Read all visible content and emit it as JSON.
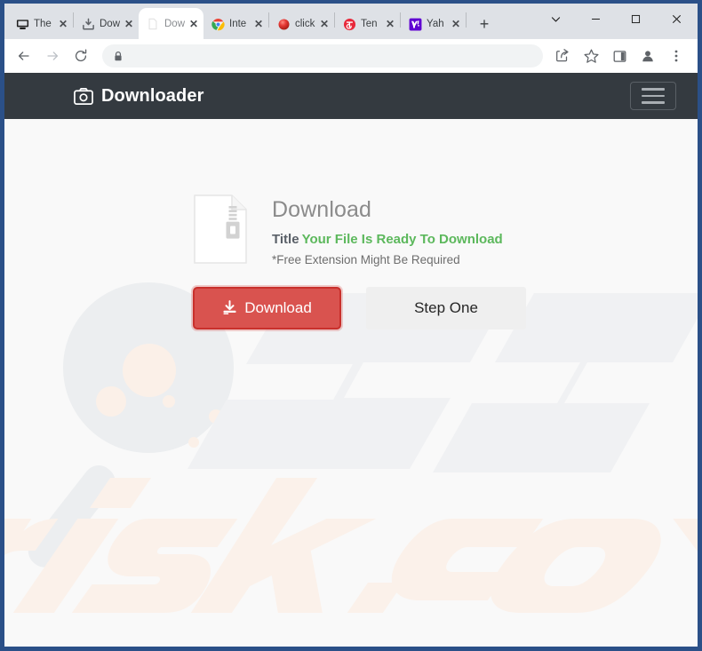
{
  "browser": {
    "tabs": [
      {
        "label": "The",
        "favicon": "monitor-icon",
        "active": false
      },
      {
        "label": "Dow",
        "favicon": "download-inbox-icon",
        "active": false
      },
      {
        "label": "Dow",
        "favicon": "blank-page-icon",
        "active": true
      },
      {
        "label": "Inte",
        "favicon": "chrome-icon",
        "active": false
      },
      {
        "label": "click",
        "favicon": "red-sphere-icon",
        "active": false
      },
      {
        "label": "Ten",
        "favicon": "red-circle-icon",
        "active": false
      },
      {
        "label": "Yah",
        "favicon": "yahoo-icon",
        "active": false
      }
    ],
    "close_label": "✕",
    "newtab_label": "+",
    "window_controls": {
      "tab_search": "tab-search-chevron",
      "minimize": "–",
      "maximize": "□",
      "close": "✕"
    },
    "toolbar": {
      "back": "back-arrow-icon",
      "forward": "forward-arrow-icon",
      "reload": "reload-icon",
      "site_info": "lock-icon",
      "url": "",
      "url_placeholder": "",
      "share": "share-icon",
      "bookmark": "star-icon",
      "side_panel": "side-panel-icon",
      "profile": "profile-avatar-icon",
      "menu": "three-dot-menu-icon"
    }
  },
  "page": {
    "navbar": {
      "brand": "Downloader",
      "brand_icon": "camera-icon",
      "menu_toggle": "hamburger-icon"
    },
    "card": {
      "file_icon": "zip-file-icon",
      "heading": "Download",
      "title_label": "Title",
      "title_value": "Your File Is Ready To Download",
      "note": "*Free Extension Might Be Required"
    },
    "buttons": {
      "download_label": "Download",
      "download_icon": "download-icon",
      "step_label": "Step One"
    },
    "watermark": {
      "text": "risk.com",
      "logo": "magnifier-icon"
    },
    "colors": {
      "navbar_bg": "#343a40",
      "page_bg": "#f9f9f9",
      "download_button": "#d9534f",
      "success_text": "#5cb85c",
      "step_button": "#efefef"
    }
  }
}
